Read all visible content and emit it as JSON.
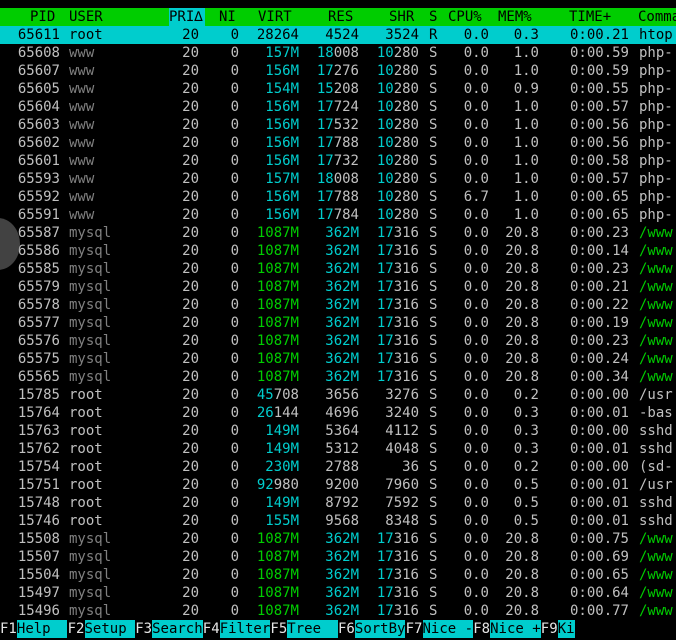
{
  "header": {
    "pid": "PID",
    "user": "USER",
    "pri": "PRI∆",
    "ni": "NI",
    "virt": "VIRT",
    "res": "RES",
    "shr": "SHR",
    "s": "S",
    "cpu": "CPU%",
    "mem": "MEM%",
    "time": "TIME+",
    "command": "Comma"
  },
  "processes": [
    {
      "pid": "65611",
      "user": "root",
      "pri": "20",
      "ni": "0",
      "virt": "28264",
      "res": "4524",
      "shr": "3524",
      "s": "R",
      "cpu": "0.0",
      "mem": "0.3",
      "time": "0:00.21",
      "cmd": "htop"
    },
    {
      "pid": "65608",
      "user": "www",
      "pri": "20",
      "ni": "0",
      "virt": "157M",
      "res": "18008",
      "shr": "10280",
      "s": "S",
      "cpu": "0.0",
      "mem": "1.0",
      "time": "0:00.59",
      "cmd": "php-"
    },
    {
      "pid": "65607",
      "user": "www",
      "pri": "20",
      "ni": "0",
      "virt": "156M",
      "res": "17276",
      "shr": "10280",
      "s": "S",
      "cpu": "0.0",
      "mem": "1.0",
      "time": "0:00.59",
      "cmd": "php-"
    },
    {
      "pid": "65605",
      "user": "www",
      "pri": "20",
      "ni": "0",
      "virt": "154M",
      "res": "15208",
      "shr": "10280",
      "s": "S",
      "cpu": "0.0",
      "mem": "0.9",
      "time": "0:00.55",
      "cmd": "php-"
    },
    {
      "pid": "65604",
      "user": "www",
      "pri": "20",
      "ni": "0",
      "virt": "156M",
      "res": "17724",
      "shr": "10280",
      "s": "S",
      "cpu": "0.0",
      "mem": "1.0",
      "time": "0:00.57",
      "cmd": "php-"
    },
    {
      "pid": "65603",
      "user": "www",
      "pri": "20",
      "ni": "0",
      "virt": "156M",
      "res": "17532",
      "shr": "10280",
      "s": "S",
      "cpu": "0.0",
      "mem": "1.0",
      "time": "0:00.56",
      "cmd": "php-"
    },
    {
      "pid": "65602",
      "user": "www",
      "pri": "20",
      "ni": "0",
      "virt": "156M",
      "res": "17788",
      "shr": "10280",
      "s": "S",
      "cpu": "0.0",
      "mem": "1.0",
      "time": "0:00.56",
      "cmd": "php-"
    },
    {
      "pid": "65601",
      "user": "www",
      "pri": "20",
      "ni": "0",
      "virt": "156M",
      "res": "17732",
      "shr": "10280",
      "s": "S",
      "cpu": "0.0",
      "mem": "1.0",
      "time": "0:00.58",
      "cmd": "php-"
    },
    {
      "pid": "65593",
      "user": "www",
      "pri": "20",
      "ni": "0",
      "virt": "157M",
      "res": "18008",
      "shr": "10280",
      "s": "S",
      "cpu": "0.0",
      "mem": "1.0",
      "time": "0:00.57",
      "cmd": "php-"
    },
    {
      "pid": "65592",
      "user": "www",
      "pri": "20",
      "ni": "0",
      "virt": "156M",
      "res": "17788",
      "shr": "10280",
      "s": "S",
      "cpu": "6.7",
      "mem": "1.0",
      "time": "0:00.65",
      "cmd": "php-"
    },
    {
      "pid": "65591",
      "user": "www",
      "pri": "20",
      "ni": "0",
      "virt": "156M",
      "res": "17784",
      "shr": "10280",
      "s": "S",
      "cpu": "0.0",
      "mem": "1.0",
      "time": "0:00.65",
      "cmd": "php-"
    },
    {
      "pid": "65587",
      "user": "mysql",
      "pri": "20",
      "ni": "0",
      "virt": "1087M",
      "res": "362M",
      "shr": "17316",
      "s": "S",
      "cpu": "0.0",
      "mem": "20.8",
      "time": "0:00.23",
      "cmd": "/www"
    },
    {
      "pid": "65586",
      "user": "mysql",
      "pri": "20",
      "ni": "0",
      "virt": "1087M",
      "res": "362M",
      "shr": "17316",
      "s": "S",
      "cpu": "0.0",
      "mem": "20.8",
      "time": "0:00.14",
      "cmd": "/www"
    },
    {
      "pid": "65585",
      "user": "mysql",
      "pri": "20",
      "ni": "0",
      "virt": "1087M",
      "res": "362M",
      "shr": "17316",
      "s": "S",
      "cpu": "0.0",
      "mem": "20.8",
      "time": "0:00.23",
      "cmd": "/www"
    },
    {
      "pid": "65579",
      "user": "mysql",
      "pri": "20",
      "ni": "0",
      "virt": "1087M",
      "res": "362M",
      "shr": "17316",
      "s": "S",
      "cpu": "0.0",
      "mem": "20.8",
      "time": "0:00.21",
      "cmd": "/www"
    },
    {
      "pid": "65578",
      "user": "mysql",
      "pri": "20",
      "ni": "0",
      "virt": "1087M",
      "res": "362M",
      "shr": "17316",
      "s": "S",
      "cpu": "0.0",
      "mem": "20.8",
      "time": "0:00.22",
      "cmd": "/www"
    },
    {
      "pid": "65577",
      "user": "mysql",
      "pri": "20",
      "ni": "0",
      "virt": "1087M",
      "res": "362M",
      "shr": "17316",
      "s": "S",
      "cpu": "0.0",
      "mem": "20.8",
      "time": "0:00.19",
      "cmd": "/www"
    },
    {
      "pid": "65576",
      "user": "mysql",
      "pri": "20",
      "ni": "0",
      "virt": "1087M",
      "res": "362M",
      "shr": "17316",
      "s": "S",
      "cpu": "0.0",
      "mem": "20.8",
      "time": "0:00.23",
      "cmd": "/www"
    },
    {
      "pid": "65575",
      "user": "mysql",
      "pri": "20",
      "ni": "0",
      "virt": "1087M",
      "res": "362M",
      "shr": "17316",
      "s": "S",
      "cpu": "0.0",
      "mem": "20.8",
      "time": "0:00.24",
      "cmd": "/www"
    },
    {
      "pid": "65565",
      "user": "mysql",
      "pri": "20",
      "ni": "0",
      "virt": "1087M",
      "res": "362M",
      "shr": "17316",
      "s": "S",
      "cpu": "0.0",
      "mem": "20.8",
      "time": "0:00.34",
      "cmd": "/www"
    },
    {
      "pid": "15785",
      "user": "root",
      "pri": "20",
      "ni": "0",
      "virt": "45708",
      "res": "3656",
      "shr": "3276",
      "s": "S",
      "cpu": "0.0",
      "mem": "0.2",
      "time": "0:00.00",
      "cmd": "/usr"
    },
    {
      "pid": "15764",
      "user": "root",
      "pri": "20",
      "ni": "0",
      "virt": "26144",
      "res": "4696",
      "shr": "3240",
      "s": "S",
      "cpu": "0.0",
      "mem": "0.3",
      "time": "0:00.01",
      "cmd": "-bas"
    },
    {
      "pid": "15763",
      "user": "root",
      "pri": "20",
      "ni": "0",
      "virt": "149M",
      "res": "5364",
      "shr": "4112",
      "s": "S",
      "cpu": "0.0",
      "mem": "0.3",
      "time": "0:00.00",
      "cmd": "sshd"
    },
    {
      "pid": "15762",
      "user": "root",
      "pri": "20",
      "ni": "0",
      "virt": "149M",
      "res": "5312",
      "shr": "4048",
      "s": "S",
      "cpu": "0.0",
      "mem": "0.3",
      "time": "0:00.01",
      "cmd": "sshd"
    },
    {
      "pid": "15754",
      "user": "root",
      "pri": "20",
      "ni": "0",
      "virt": "230M",
      "res": "2788",
      "shr": "36",
      "s": "S",
      "cpu": "0.0",
      "mem": "0.2",
      "time": "0:00.00",
      "cmd": "(sd-"
    },
    {
      "pid": "15751",
      "user": "root",
      "pri": "20",
      "ni": "0",
      "virt": "92980",
      "res": "9200",
      "shr": "7960",
      "s": "S",
      "cpu": "0.0",
      "mem": "0.5",
      "time": "0:00.01",
      "cmd": "/usr"
    },
    {
      "pid": "15748",
      "user": "root",
      "pri": "20",
      "ni": "0",
      "virt": "149M",
      "res": "8792",
      "shr": "7592",
      "s": "S",
      "cpu": "0.0",
      "mem": "0.5",
      "time": "0:00.01",
      "cmd": "sshd"
    },
    {
      "pid": "15746",
      "user": "root",
      "pri": "20",
      "ni": "0",
      "virt": "155M",
      "res": "9568",
      "shr": "8348",
      "s": "S",
      "cpu": "0.0",
      "mem": "0.5",
      "time": "0:00.01",
      "cmd": "sshd"
    },
    {
      "pid": "15508",
      "user": "mysql",
      "pri": "20",
      "ni": "0",
      "virt": "1087M",
      "res": "362M",
      "shr": "17316",
      "s": "S",
      "cpu": "0.0",
      "mem": "20.8",
      "time": "0:00.75",
      "cmd": "/www"
    },
    {
      "pid": "15507",
      "user": "mysql",
      "pri": "20",
      "ni": "0",
      "virt": "1087M",
      "res": "362M",
      "shr": "17316",
      "s": "S",
      "cpu": "0.0",
      "mem": "20.8",
      "time": "0:00.69",
      "cmd": "/www"
    },
    {
      "pid": "15504",
      "user": "mysql",
      "pri": "20",
      "ni": "0",
      "virt": "1087M",
      "res": "362M",
      "shr": "17316",
      "s": "S",
      "cpu": "0.0",
      "mem": "20.8",
      "time": "0:00.65",
      "cmd": "/www"
    },
    {
      "pid": "15497",
      "user": "mysql",
      "pri": "20",
      "ni": "0",
      "virt": "1087M",
      "res": "362M",
      "shr": "17316",
      "s": "S",
      "cpu": "0.0",
      "mem": "20.8",
      "time": "0:00.64",
      "cmd": "/www"
    },
    {
      "pid": "15496",
      "user": "mysql",
      "pri": "20",
      "ni": "0",
      "virt": "1087M",
      "res": "362M",
      "shr": "17316",
      "s": "S",
      "cpu": "0.0",
      "mem": "20.8",
      "time": "0:00.77",
      "cmd": "/www"
    }
  ],
  "footer": [
    {
      "key": "F1",
      "label": "Help  "
    },
    {
      "key": "F2",
      "label": "Setup "
    },
    {
      "key": "F3",
      "label": "Search"
    },
    {
      "key": "F4",
      "label": "Filter"
    },
    {
      "key": "F5",
      "label": "Tree  "
    },
    {
      "key": "F6",
      "label": "SortBy"
    },
    {
      "key": "F7",
      "label": "Nice -"
    },
    {
      "key": "F8",
      "label": "Nice +"
    },
    {
      "key": "F9",
      "label": "Ki"
    }
  ],
  "colors": {
    "header_bg": "#00cd00",
    "selected_bg": "#00cdcd",
    "footer_label_bg": "#00cdcd"
  }
}
